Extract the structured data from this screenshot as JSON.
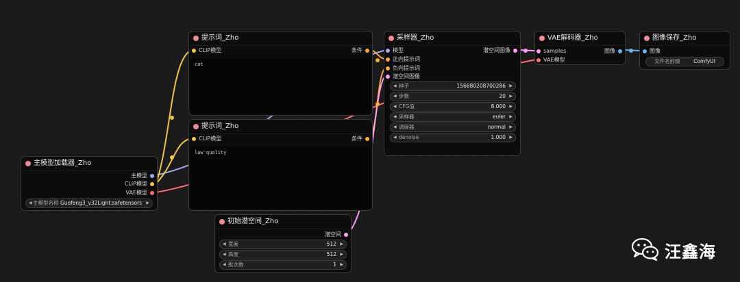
{
  "colors": {
    "model": "#a6a6f0",
    "clip": "#f5c542",
    "vae": "#ff6e6e",
    "conditioning": "#ffa931",
    "latent": "#ff9cf9",
    "image": "#64b5f6",
    "title_dot": "#f08a97"
  },
  "nodes": {
    "model_loader": {
      "title": "主模型加载器_Zho",
      "outputs": {
        "model": "主模型",
        "clip": "CLIP模型",
        "vae": "VAE模型"
      },
      "widget": {
        "label": "主模型名称",
        "value": "Guofeng3_v32Light.safetensors"
      }
    },
    "prompt_pos": {
      "title": "提示词_Zho",
      "input_clip": "CLIP模型",
      "output": "条件",
      "text": "cat"
    },
    "prompt_neg": {
      "title": "提示词_Zho",
      "input_clip": "CLIP模型",
      "output": "条件",
      "text": "low quality"
    },
    "latent": {
      "title": "初始潜空间_Zho",
      "output": "潜空间",
      "widgets": [
        {
          "label": "宽度",
          "value": "512"
        },
        {
          "label": "高度",
          "value": "512"
        },
        {
          "label": "批次数",
          "value": "1"
        }
      ]
    },
    "sampler": {
      "title": "采样器_Zho",
      "inputs": {
        "model": "模型",
        "positive": "正向提示词",
        "negative": "负向提示词",
        "latent": "潜空间图像"
      },
      "output": "潜空间图像",
      "widgets": [
        {
          "label": "种子",
          "value": "156680208700286"
        },
        {
          "label": "步数",
          "value": "20"
        },
        {
          "label": "CFG值",
          "value": "8.000"
        },
        {
          "label": "采样器",
          "value": "euler"
        },
        {
          "label": "调度器",
          "value": "normal"
        },
        {
          "label": "denoise",
          "value": "1.000"
        }
      ]
    },
    "vae_decode": {
      "title": "VAE解码器_Zho",
      "inputs": {
        "samples": "samples",
        "vae": "VAE模型"
      },
      "output": "图像"
    },
    "save_image": {
      "title": "图像保存_Zho",
      "input": "图像",
      "widget": {
        "label": "文件名前缀",
        "value": "ComfyUI"
      }
    }
  },
  "watermark": {
    "icon": "wechat-icon",
    "text": "汪鑫海"
  }
}
